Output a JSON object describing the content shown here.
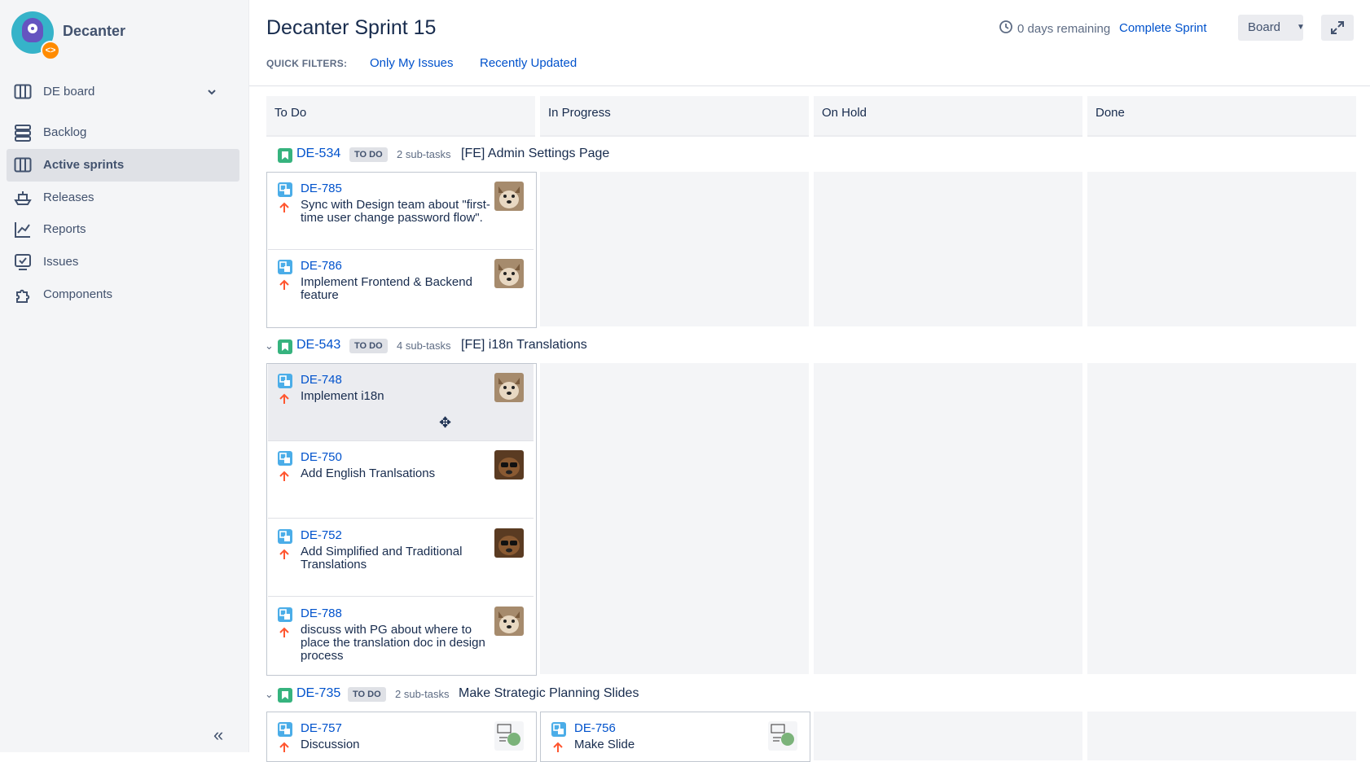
{
  "sidebar": {
    "project_name": "Decanter",
    "board_select": "DE board",
    "nav": [
      {
        "label": "Backlog",
        "icon": "backlog-icon"
      },
      {
        "label": "Active sprints",
        "icon": "board-icon",
        "active": true
      },
      {
        "label": "Releases",
        "icon": "ship-icon"
      },
      {
        "label": "Reports",
        "icon": "chart-icon"
      },
      {
        "label": "Issues",
        "icon": "issues-icon"
      },
      {
        "label": "Components",
        "icon": "puzzle-icon"
      }
    ]
  },
  "header": {
    "title": "Decanter Sprint 15",
    "quick_filters_label": "QUICK FILTERS:",
    "quick_filters": [
      "Only My Issues",
      "Recently Updated"
    ],
    "days_remaining": "0 days remaining",
    "complete_sprint": "Complete Sprint",
    "board_button": "Board"
  },
  "columns": [
    "To Do",
    "In Progress",
    "On Hold",
    "Done"
  ],
  "swimlanes": [
    {
      "key": "DE-534",
      "status": "TO DO",
      "subtasks": "2 sub-tasks",
      "title": "[FE] Admin Settings Page",
      "cards": [
        {
          "key": "DE-785",
          "summary": "Sync with Design team about \"first-time user change password flow\"."
        },
        {
          "key": "DE-786",
          "summary": "Implement Frontend & Backend feature"
        }
      ]
    },
    {
      "key": "DE-543",
      "status": "TO DO",
      "subtasks": "4 sub-tasks",
      "title": "[FE] i18n Translations",
      "cards": [
        {
          "key": "DE-748",
          "summary": "Implement i18n"
        },
        {
          "key": "DE-750",
          "summary": "Add English Tranlsations"
        },
        {
          "key": "DE-752",
          "summary": "Add Simplified and Traditional Translations"
        },
        {
          "key": "DE-788",
          "summary": "discuss with PG about where to place the translation doc in design process"
        }
      ]
    },
    {
      "key": "DE-735",
      "status": "TO DO",
      "subtasks": "2 sub-tasks",
      "title": "Make Strategic Planning Slides",
      "cards": [
        {
          "key": "DE-757",
          "summary": "Discussion"
        },
        {
          "key": "DE-756",
          "summary": "Make Slide"
        }
      ]
    }
  ],
  "colors": {
    "link": "#0052cc",
    "story": "#36b37e",
    "subtask": "#4bade8",
    "priority": "#ff5630"
  }
}
